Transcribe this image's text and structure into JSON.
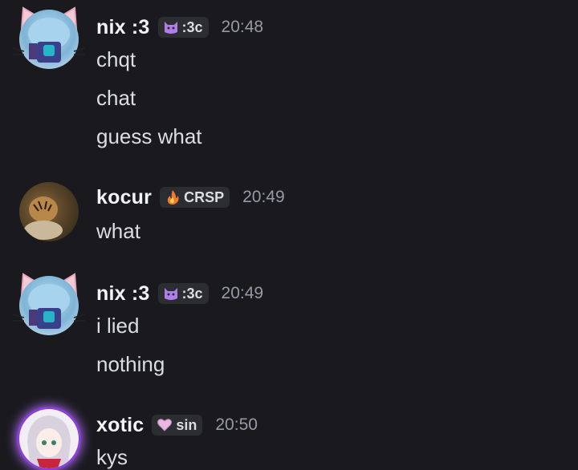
{
  "messages": [
    {
      "author": "nix :3",
      "tag": "🐱:3c",
      "tag_text": ":3c",
      "timestamp": "20:48",
      "lines": [
        "chqt",
        "chat",
        "guess what"
      ]
    },
    {
      "author": "kocur",
      "tag_text": "CRSP",
      "timestamp": "20:49",
      "lines": [
        "what"
      ]
    },
    {
      "author": "nix :3",
      "tag_text": ":3c",
      "timestamp": "20:49",
      "lines": [
        "i lied",
        "nothing"
      ]
    },
    {
      "author": "xotic",
      "tag_text": "sin",
      "timestamp": "20:50",
      "lines": [
        "kys"
      ]
    }
  ],
  "icons": {
    "cat_tag": "purple-cat-icon",
    "fire_tag": "fire-icon",
    "heart_tag": "heart-icon"
  },
  "colors": {
    "background": "#1a1a1e",
    "username": "#f2f3f5",
    "message_text": "#dbdee1",
    "timestamp": "#949ba4",
    "tag_background": "#2b2d31"
  }
}
